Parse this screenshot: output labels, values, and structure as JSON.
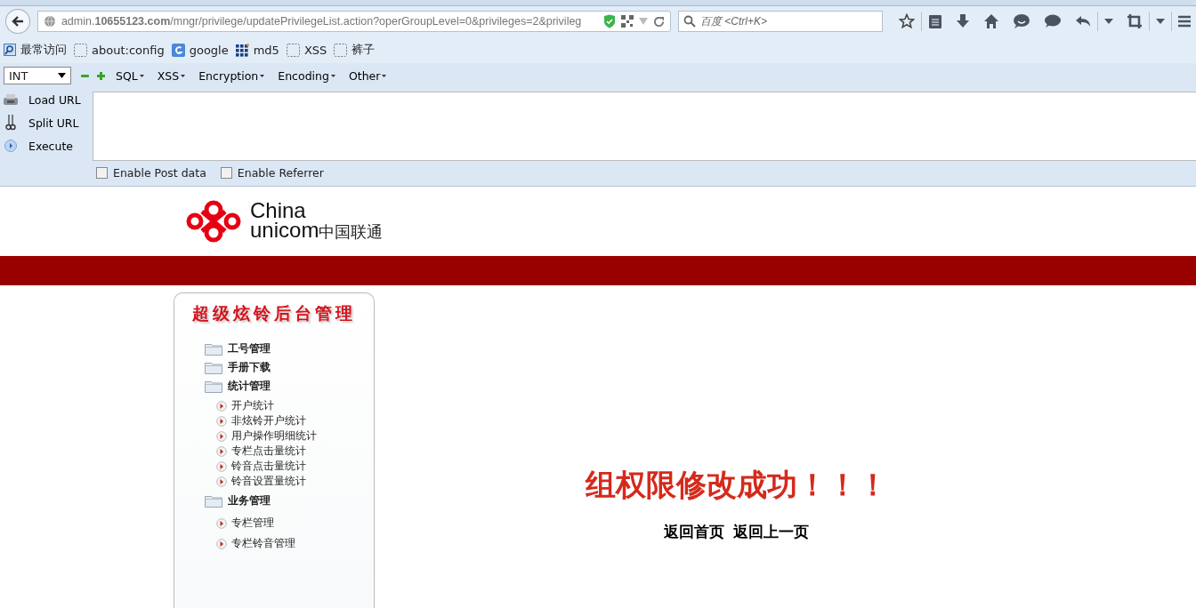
{
  "browser": {
    "url": "admin.**10655123.com**/mngr/privilege/updatePrivilegeList.action?operGroupLevel=0&privileges=2&privileg",
    "search": {
      "placeholder": "百度 <Ctrl+K>"
    }
  },
  "bookmarks": [
    "最常访问",
    "about:config",
    "google",
    "md5",
    "XSS",
    "裤子"
  ],
  "hackbar": {
    "select": "INT",
    "menus": [
      "SQL",
      "XSS",
      "Encryption",
      "Encoding",
      "Other"
    ],
    "actions": [
      {
        "label": "Load URL",
        "kind": "load"
      },
      {
        "label": "Split URL",
        "kind": "split"
      },
      {
        "label": "Execute",
        "kind": "execute"
      }
    ],
    "options": [
      {
        "label": "Enable Post data",
        "checked": false
      },
      {
        "label": "Enable Referrer",
        "checked": false
      }
    ]
  },
  "logo": {
    "latin_1": "China",
    "latin_2": "unicom",
    "chinese": "中国联通"
  },
  "sidebar": {
    "title": "超级炫铃后台管理",
    "items": [
      {
        "label": "工号管理"
      },
      {
        "label": "手册下载"
      },
      {
        "label": "统计管理",
        "children": [
          {
            "label": "开户统计"
          },
          {
            "label": "非炫铃开户统计"
          },
          {
            "label": "用户操作明细统计"
          },
          {
            "label": "专栏点击量统计"
          },
          {
            "label": "铃音点击量统计"
          },
          {
            "label": "铃音设置量统计"
          }
        ]
      },
      {
        "label": "业务管理",
        "children": [
          {
            "label": "专栏管理"
          },
          {
            "label": "专栏铃音管理"
          }
        ]
      }
    ]
  },
  "message": "组权限修改成功！！！",
  "links": [
    "返回首页",
    "返回上一页"
  ]
}
